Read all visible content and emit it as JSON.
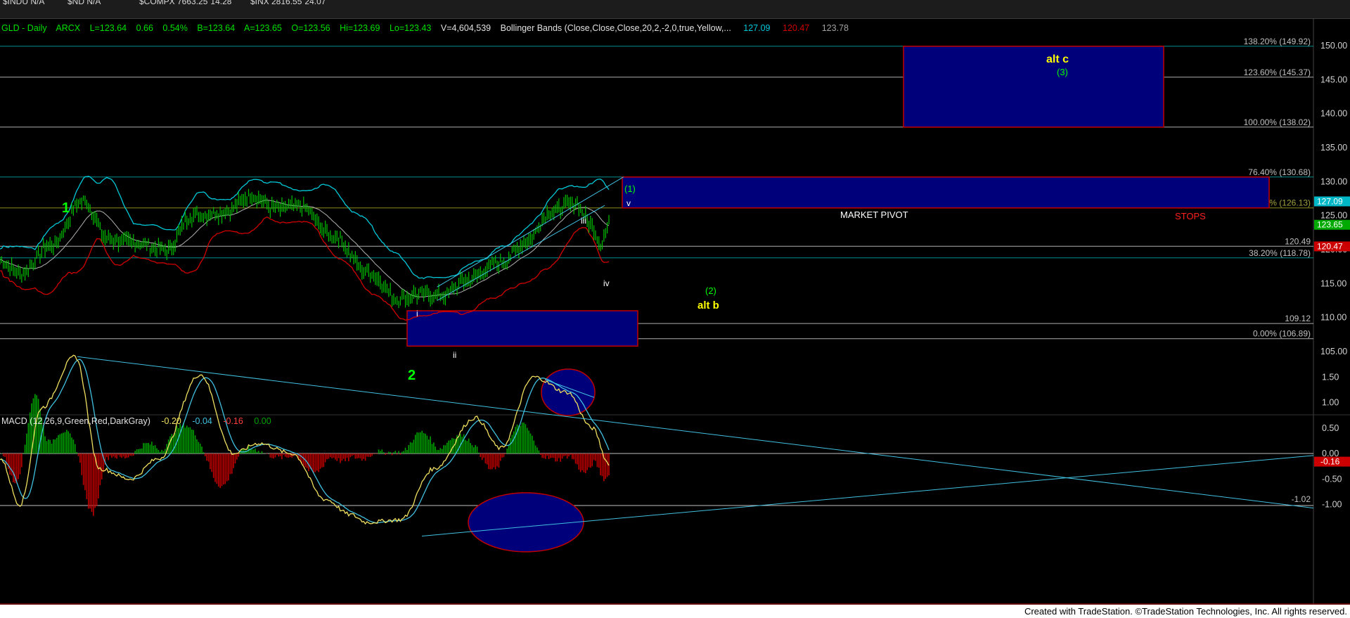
{
  "topbar": [
    {
      "symbol": "$INDU N/A",
      "change": ""
    },
    {
      "symbol": "$ND N/A",
      "change": ""
    },
    {
      "symbol": "$COMPX 7663.25",
      "change": "14.28"
    },
    {
      "symbol": "$INX 2816.55",
      "change": "24.07"
    }
  ],
  "header": {
    "symbol": "GLD - Daily",
    "exchange": "ARCX",
    "last": "L=123.64",
    "change": "0.66",
    "pct": "0.54%",
    "bid": "B=123.64",
    "ask": "A=123.65",
    "open": "O=123.56",
    "high": "Hi=123.69",
    "low": "Lo=123.43",
    "volume": "V=4,604,539",
    "indicator": "Bollinger Bands (Close,Close,Close,20,2,-2,0,true,Yellow,...",
    "bb_upper": "127.09",
    "bb_lower": "120.47",
    "bb_mid": "123.78"
  },
  "macd_header": {
    "label": "MACD (12,26,9,Green,Red,DarkGray)",
    "v1": "-0.20",
    "v2": "-0.04",
    "v3": "-0.16",
    "v4": "0.00"
  },
  "price_axis_ticks": [
    "150.00",
    "145.00",
    "140.00",
    "135.00",
    "130.00",
    "125.00",
    "120.00",
    "115.00",
    "110.00",
    "105.00"
  ],
  "macd_axis_ticks": [
    "1.50",
    "1.00",
    "0.50",
    "0.00",
    "-0.50",
    "-1.00"
  ],
  "price_axis_tags": [
    {
      "text": "127.09",
      "color": "#00b7c8",
      "value": 127.09
    },
    {
      "text": "123.65",
      "color": "#00aa00",
      "value": 123.65
    },
    {
      "text": "120.47",
      "color": "#cc0000",
      "value": 120.47
    }
  ],
  "macd_axis_tag": {
    "text": "-0.16",
    "color": "#cc0000",
    "value": -0.16
  },
  "fib_levels": [
    {
      "label": "138.20% (149.92)",
      "value": 149.92,
      "color": "#00a0a0"
    },
    {
      "label": "123.60% (145.37)",
      "value": 145.37,
      "color": "#c0c0c0"
    },
    {
      "label": "100.00% (138.02)",
      "value": 138.02,
      "color": "#c0c0c0"
    },
    {
      "label": "76.40% (130.68)",
      "value": 130.68,
      "color": "#00a0a0"
    },
    {
      "label": "61.80% (126.13)",
      "value": 126.13,
      "color": "#9a9a20"
    },
    {
      "label": "120.49",
      "value": 120.49,
      "color": "#c0c0c0"
    },
    {
      "label": "38.20% (118.78)",
      "value": 118.78,
      "color": "#00a0a0"
    },
    {
      "label": "109.12",
      "value": 109.12,
      "color": "#c0c0c0"
    },
    {
      "label": "0.00% (106.89)",
      "value": 106.89,
      "color": "#c0c0c0"
    }
  ],
  "macd_level_label": "-1.02",
  "annotations": {
    "wave_1": "1",
    "wave_2": "2",
    "wave_i": "i",
    "wave_ii": "ii",
    "wave_iii": "iii",
    "wave_iv": "iv",
    "wave_v": "v",
    "wave_1p": "(1)",
    "wave_2p": "(2)",
    "alt_b": "alt b",
    "alt_c": "alt c",
    "wave_3p": "(3)",
    "market_pivot": "MARKET PIVOT",
    "stops": "STOPS"
  },
  "credit": "Created with TradeStation. ©TradeStation Technologies, Inc. All rights reserved.",
  "colors": {
    "background": "#000000",
    "box_fill": "#00007a",
    "box_border": "#c00000",
    "bb_upper": "#00c8d8",
    "bb_lower": "#d00000",
    "bb_mid": "#b0b0b0",
    "price_bars": "#00c000",
    "macd_line": "#f0e060",
    "signal_line": "#40c0e0",
    "hist_pos": "#00a000",
    "hist_neg": "#c00000",
    "annotation_green": "#00ff00",
    "annotation_yellow": "#ffff00",
    "annotation_white": "#ffffff"
  },
  "chart_data": [
    {
      "type": "candlestick",
      "title": "GLD - Daily",
      "y_axis": "price",
      "ylim": [
        103,
        152
      ],
      "price_path_keypoints": [
        {
          "bar": 0,
          "close": 118.5
        },
        {
          "bar": 12,
          "close": 116.5
        },
        {
          "bar": 30,
          "close": 120.5
        },
        {
          "bar": 50,
          "close": 127.2
        },
        {
          "bar": 65,
          "close": 121.5
        },
        {
          "bar": 80,
          "close": 121.0
        },
        {
          "bar": 100,
          "close": 120.0
        },
        {
          "bar": 115,
          "close": 125.0
        },
        {
          "bar": 135,
          "close": 125.5
        },
        {
          "bar": 150,
          "close": 128.0
        },
        {
          "bar": 165,
          "close": 126.0
        },
        {
          "bar": 180,
          "close": 126.3
        },
        {
          "bar": 200,
          "close": 122.0
        },
        {
          "bar": 220,
          "close": 116.8
        },
        {
          "bar": 240,
          "close": 112.7
        },
        {
          "bar": 252,
          "close": 113.5
        },
        {
          "bar": 265,
          "close": 113.2
        },
        {
          "bar": 280,
          "close": 115.5
        },
        {
          "bar": 300,
          "close": 118.0
        },
        {
          "bar": 315,
          "close": 121.0
        },
        {
          "bar": 330,
          "close": 125.5
        },
        {
          "bar": 345,
          "close": 126.8
        },
        {
          "bar": 355,
          "close": 123.5
        },
        {
          "bar": 360,
          "close": 121.0
        },
        {
          "bar": 365,
          "close": 123.6
        }
      ],
      "bollinger_upper_last": 127.09,
      "bollinger_lower_last": 120.47,
      "bollinger_mid_last": 123.78
    },
    {
      "type": "line",
      "title": "MACD (12,26,9,Green,Red,DarkGray)",
      "ylim": [
        -1.62,
        2.1
      ],
      "macd_keypoints": [
        {
          "bar": 0,
          "value": -0.1
        },
        {
          "bar": 12,
          "value": -1.0
        },
        {
          "bar": 25,
          "value": 0.9
        },
        {
          "bar": 45,
          "value": 1.9
        },
        {
          "bar": 60,
          "value": -0.3
        },
        {
          "bar": 78,
          "value": -0.5
        },
        {
          "bar": 95,
          "value": -0.1
        },
        {
          "bar": 120,
          "value": 1.55
        },
        {
          "bar": 140,
          "value": 0.0
        },
        {
          "bar": 155,
          "value": 0.2
        },
        {
          "bar": 175,
          "value": 0.0
        },
        {
          "bar": 195,
          "value": -0.9
        },
        {
          "bar": 210,
          "value": -1.2
        },
        {
          "bar": 220,
          "value": -1.35
        },
        {
          "bar": 240,
          "value": -1.3
        },
        {
          "bar": 260,
          "value": -0.3
        },
        {
          "bar": 285,
          "value": 0.7
        },
        {
          "bar": 300,
          "value": 0.1
        },
        {
          "bar": 320,
          "value": 1.5
        },
        {
          "bar": 340,
          "value": 1.2
        },
        {
          "bar": 355,
          "value": 0.5
        },
        {
          "bar": 365,
          "value": -0.2
        }
      ],
      "signal_last": -0.04,
      "histogram_last": -0.16
    }
  ]
}
